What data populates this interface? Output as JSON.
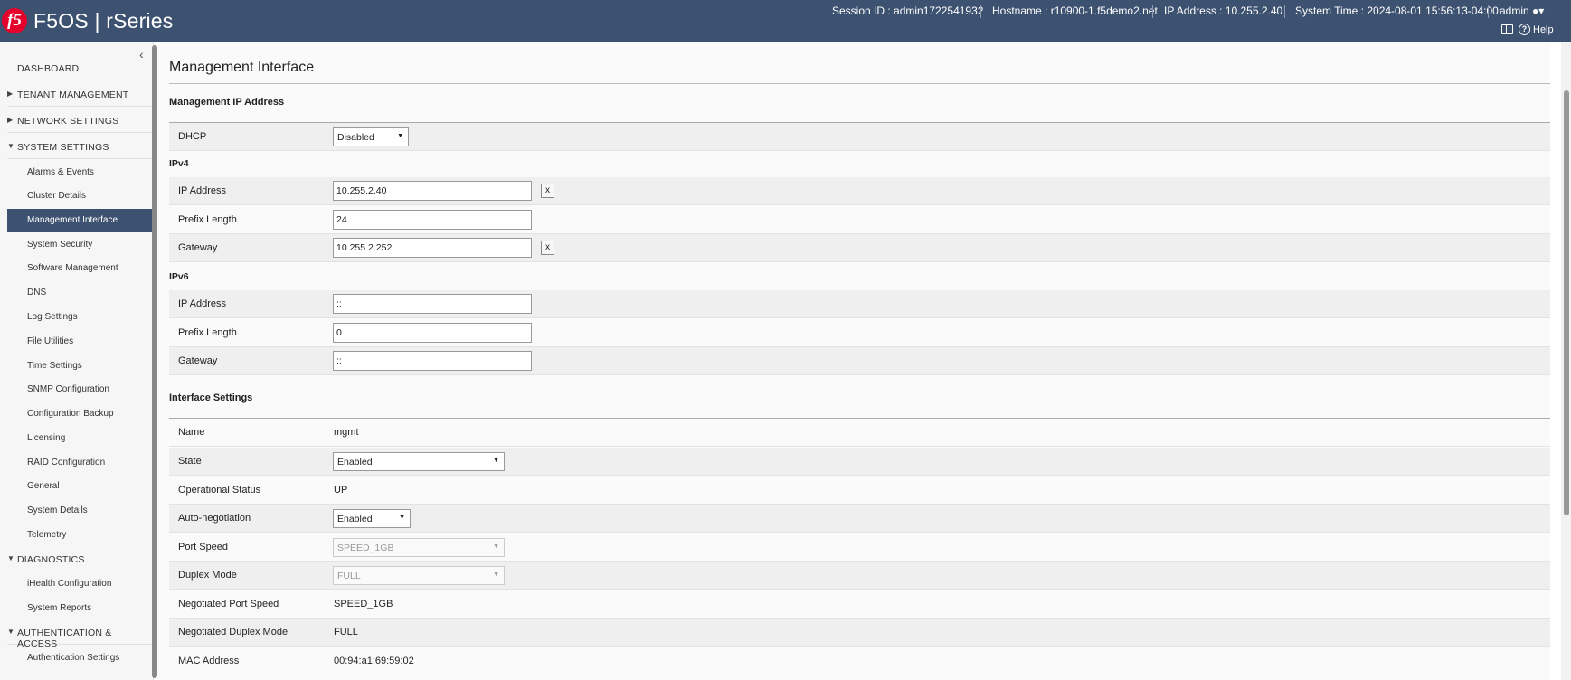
{
  "header": {
    "logo": "f5",
    "title": "F5OS | rSeries",
    "session": "Session ID : admin1722541932",
    "hostname": "Hostname : r10900-1.f5demo2.net",
    "ip": "IP Address : 10.255.2.40",
    "time": "System Time : 2024-08-01 15:56:13-04:00",
    "user": "admin",
    "help": "Help"
  },
  "sidebar": {
    "dashboard": "DASHBOARD",
    "tenant": "TENANT MANAGEMENT",
    "network": "NETWORK SETTINGS",
    "system": "SYSTEM SETTINGS",
    "system_items": [
      "Alarms & Events",
      "Cluster Details",
      "Management Interface",
      "System Security",
      "Software Management",
      "DNS",
      "Log Settings",
      "File Utilities",
      "Time Settings",
      "SNMP Configuration",
      "Configuration Backup",
      "Licensing",
      "RAID Configuration",
      "General",
      "System Details",
      "Telemetry"
    ],
    "diagnostics": "DIAGNOSTICS",
    "diag_items": [
      "iHealth Configuration",
      "System Reports"
    ],
    "auth": "AUTHENTICATION & ACCESS",
    "auth_items": [
      "Authentication Settings"
    ]
  },
  "main": {
    "title": "Management Interface",
    "mgmt_ip_title": "Management IP Address",
    "dhcp_label": "DHCP",
    "dhcp_value": "Disabled",
    "ipv4_title": "IPv4",
    "ipv4": {
      "ip_label": "IP Address",
      "ip_value": "10.255.2.40",
      "prefix_label": "Prefix Length",
      "prefix_value": "24",
      "gw_label": "Gateway",
      "gw_value": "10.255.2.252"
    },
    "ipv6_title": "IPv6",
    "ipv6": {
      "ip_label": "IP Address",
      "ip_value": "::",
      "prefix_label": "Prefix Length",
      "prefix_value": "0",
      "gw_label": "Gateway",
      "gw_value": "::"
    },
    "clear": "x",
    "iface_title": "Interface Settings",
    "iface": {
      "name_label": "Name",
      "name_value": "mgmt",
      "state_label": "State",
      "state_value": "Enabled",
      "op_label": "Operational Status",
      "op_value": "UP",
      "auto_label": "Auto-negotiation",
      "auto_value": "Enabled",
      "speed_label": "Port Speed",
      "speed_value": "SPEED_1GB",
      "duplex_label": "Duplex Mode",
      "duplex_value": "FULL",
      "neg_speed_label": "Negotiated Port Speed",
      "neg_speed_value": "SPEED_1GB",
      "neg_duplex_label": "Negotiated Duplex Mode",
      "neg_duplex_value": "FULL",
      "mac_label": "MAC Address",
      "mac_value": "00:94:a1:69:59:02"
    }
  }
}
